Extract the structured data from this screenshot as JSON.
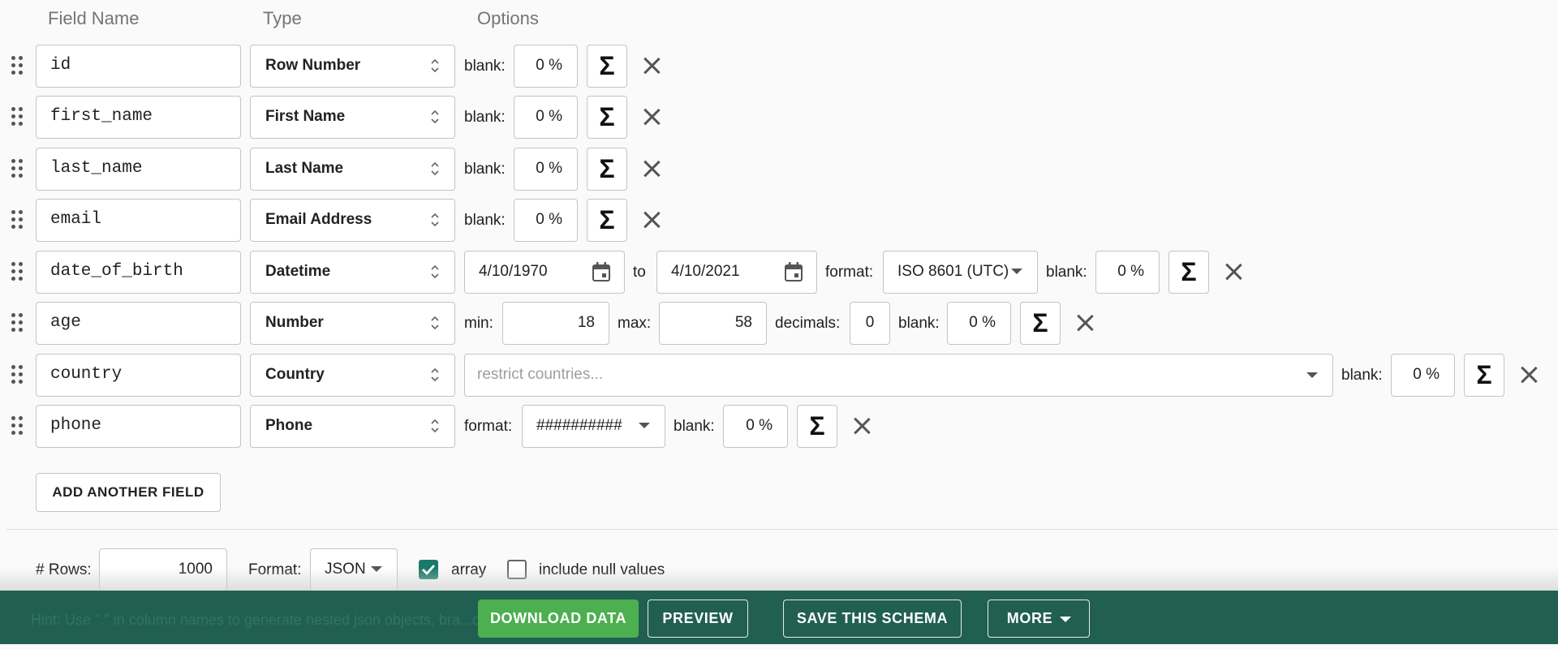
{
  "headers": {
    "field_name": "Field Name",
    "type": "Type",
    "options": "Options"
  },
  "labels": {
    "blank": "blank:",
    "to": "to",
    "format": "format:",
    "min": "min:",
    "max": "max:",
    "decimals": "decimals:"
  },
  "sigma_symbol": "Σ",
  "fields": [
    {
      "name": "id",
      "type": "Row Number",
      "blank": "0 %"
    },
    {
      "name": "first_name",
      "type": "First Name",
      "blank": "0 %"
    },
    {
      "name": "last_name",
      "type": "Last Name",
      "blank": "0 %"
    },
    {
      "name": "email",
      "type": "Email Address",
      "blank": "0 %"
    },
    {
      "name": "date_of_birth",
      "type": "Datetime",
      "from": "4/10/1970",
      "to": "4/10/2021",
      "format": "ISO 8601 (UTC)",
      "blank": "0 %"
    },
    {
      "name": "age",
      "type": "Number",
      "min": "18",
      "max": "58",
      "decimals": "0",
      "blank": "0 %"
    },
    {
      "name": "country",
      "type": "Country",
      "restrict_placeholder": "restrict countries...",
      "blank": "0 %"
    },
    {
      "name": "phone",
      "type": "Phone",
      "format": "##########",
      "blank": "0 %"
    }
  ],
  "add_field_label": "ADD ANOTHER FIELD",
  "settings": {
    "rows_label": "# Rows:",
    "rows_value": "1000",
    "format_label": "Format:",
    "format_value": "JSON",
    "array_label": "array",
    "array_checked": true,
    "include_null_label": "include null values",
    "include_null_checked": false
  },
  "footer": {
    "hint": "Hint: Use \".\" in column names to generate nested json objects, bra...on...",
    "download": "DOWNLOAD DATA",
    "preview": "PREVIEW",
    "save_schema": "SAVE THIS SCHEMA",
    "more": "MORE"
  },
  "colors": {
    "accent_green": "#4caf50",
    "footer_bg": "#215f52",
    "checkbox_teal": "#1a7a6a"
  },
  "icons": [
    "drag-handle-icon",
    "updown-arrows-icon",
    "sigma-icon",
    "close-icon",
    "calendar-icon",
    "caret-down-icon",
    "checkmark-icon"
  ]
}
